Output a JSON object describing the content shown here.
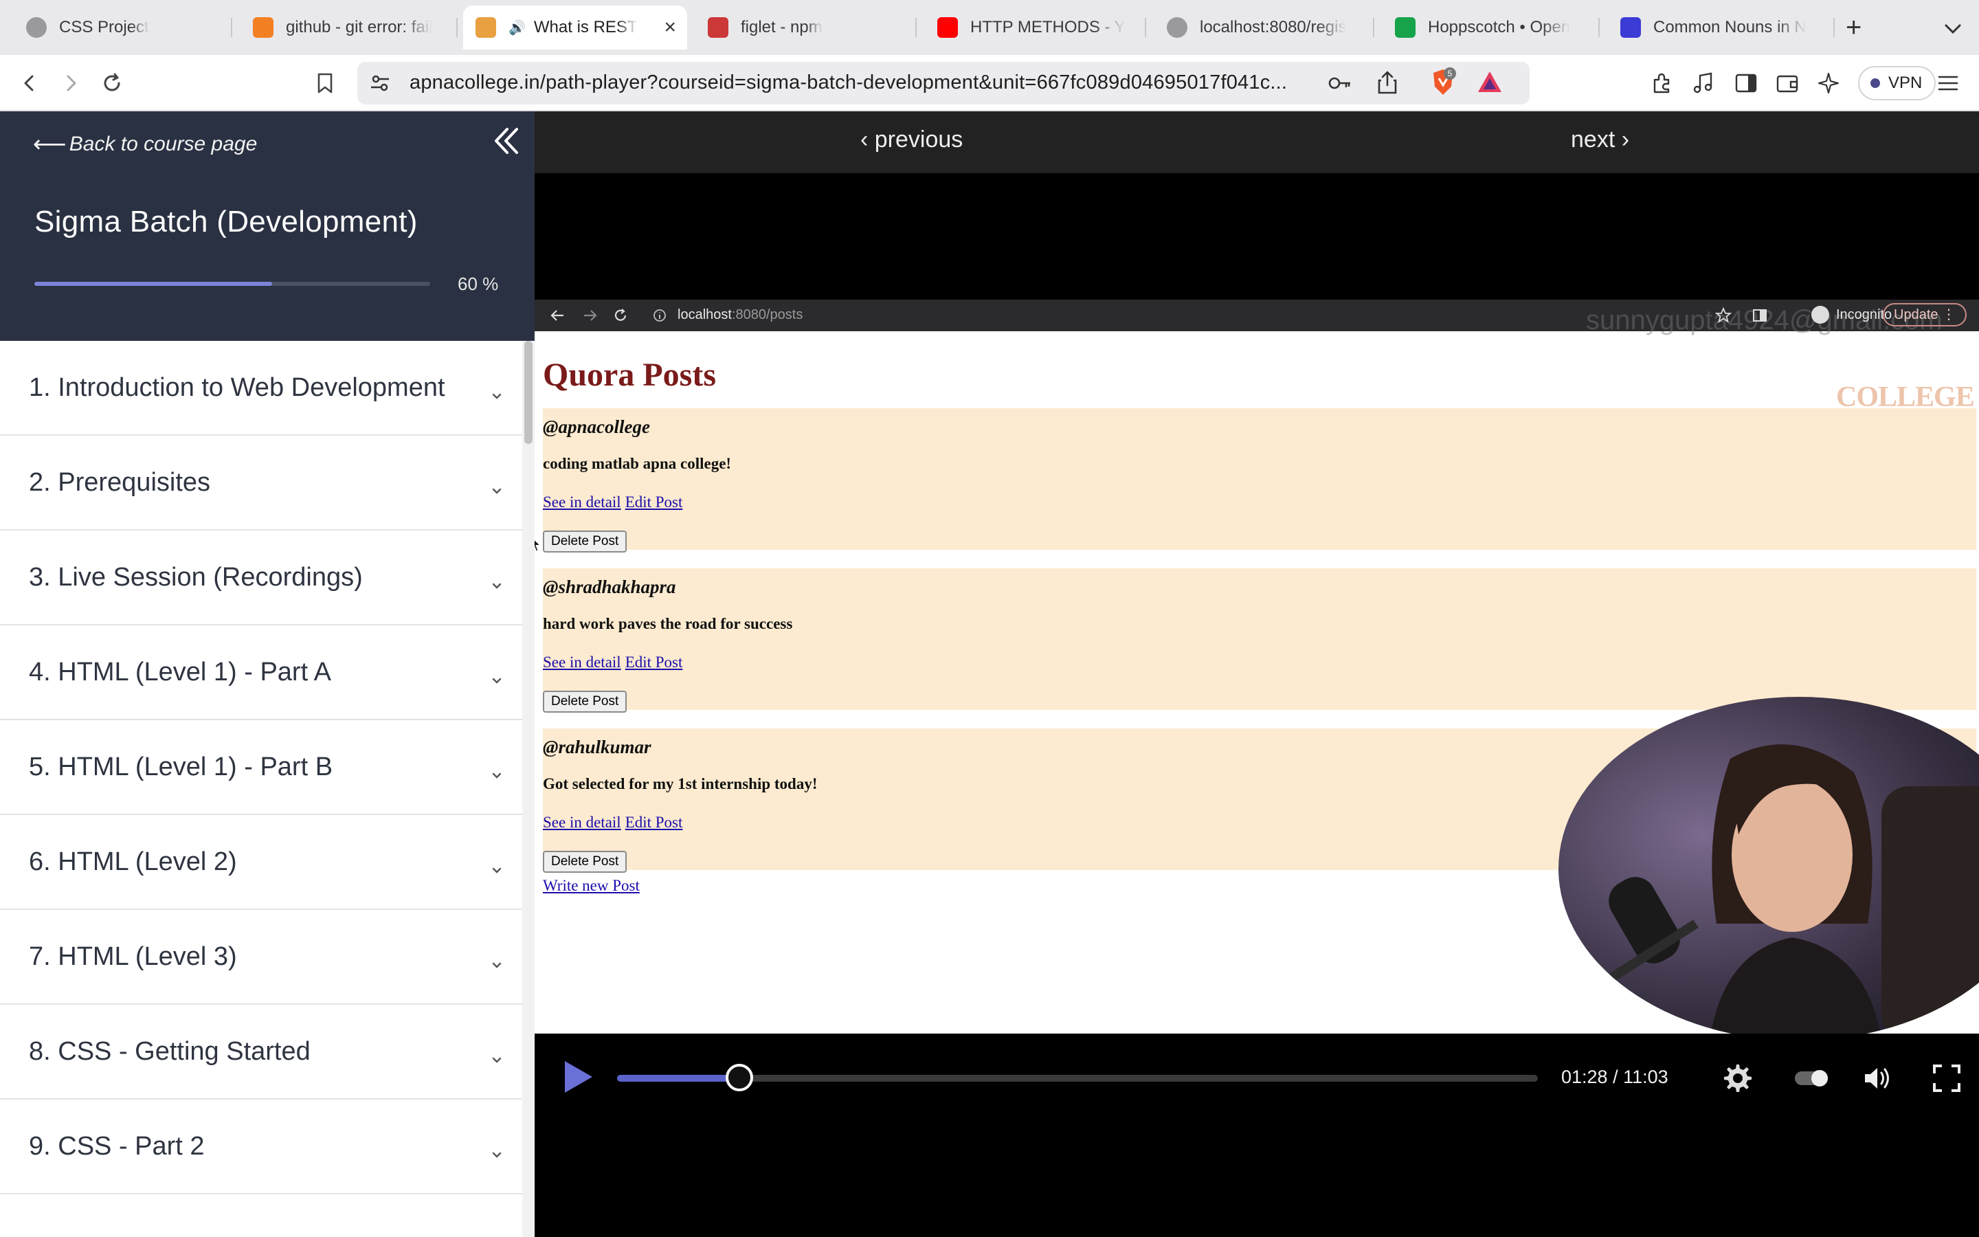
{
  "browser": {
    "tabs": [
      {
        "title": "CSS Project",
        "icon": "globe-icon"
      },
      {
        "title": "github - git error: fail",
        "icon": "stackoverflow-icon"
      },
      {
        "title": "What is REST",
        "icon": "apnacollege-icon",
        "active": true
      },
      {
        "title": "figlet - npm",
        "icon": "npm-icon"
      },
      {
        "title": "HTTP METHODS - Y",
        "icon": "youtube-icon"
      },
      {
        "title": "localhost:8080/regis",
        "icon": "globe-icon"
      },
      {
        "title": "Hoppscotch • Open",
        "icon": "hoppscotch-icon"
      },
      {
        "title": "Common Nouns in N",
        "icon": "copilot-icon"
      }
    ],
    "address": "apnacollege.in/path-player?courseid=sigma-batch-development&unit=667fc089d04695017f041c...",
    "brave_shield_count": "5",
    "vpn_label": "VPN"
  },
  "sidebar": {
    "back_label": "Back to course page",
    "course_title": "Sigma Batch (Development)",
    "progress": 0.6,
    "progress_label": "60 %",
    "units": [
      "1. Introduction to Web Development",
      "2. Prerequisites",
      "3. Live Session (Recordings)",
      "4. HTML (Level 1) - Part A",
      "5. HTML (Level 1) - Part B",
      "6. HTML (Level 2)",
      "7. HTML (Level 3)",
      "8. CSS - Getting Started",
      "9. CSS - Part 2"
    ]
  },
  "player": {
    "prev_label": "‹ previous",
    "next_label": "next ›",
    "video": {
      "browser_url_host": "localhost",
      "browser_url_path": ":8080/posts",
      "incognito_label": "Incognito",
      "update_label": "Update",
      "watermark_email": "sunnygupta4924@gmail.com",
      "watermark_logo": "COLLEGE",
      "page_title": "Quora Posts",
      "posts": [
        {
          "username": "@apnacollege",
          "content": "coding matlab apna college!"
        },
        {
          "username": "@shradhakhapra",
          "content": "hard work paves the road for success"
        },
        {
          "username": "@rahulkumar",
          "content": "Got selected for my 1st internship today!"
        }
      ],
      "see_detail_label": "See in detail",
      "edit_label": "Edit Post",
      "delete_label": "Delete Post",
      "write_new_label": "Write new Post"
    },
    "time_current": "01:28",
    "time_total": "11:03",
    "time_display": "01:28 / 11:03",
    "played_fraction": 0.133,
    "accent": "#5b63c9"
  }
}
